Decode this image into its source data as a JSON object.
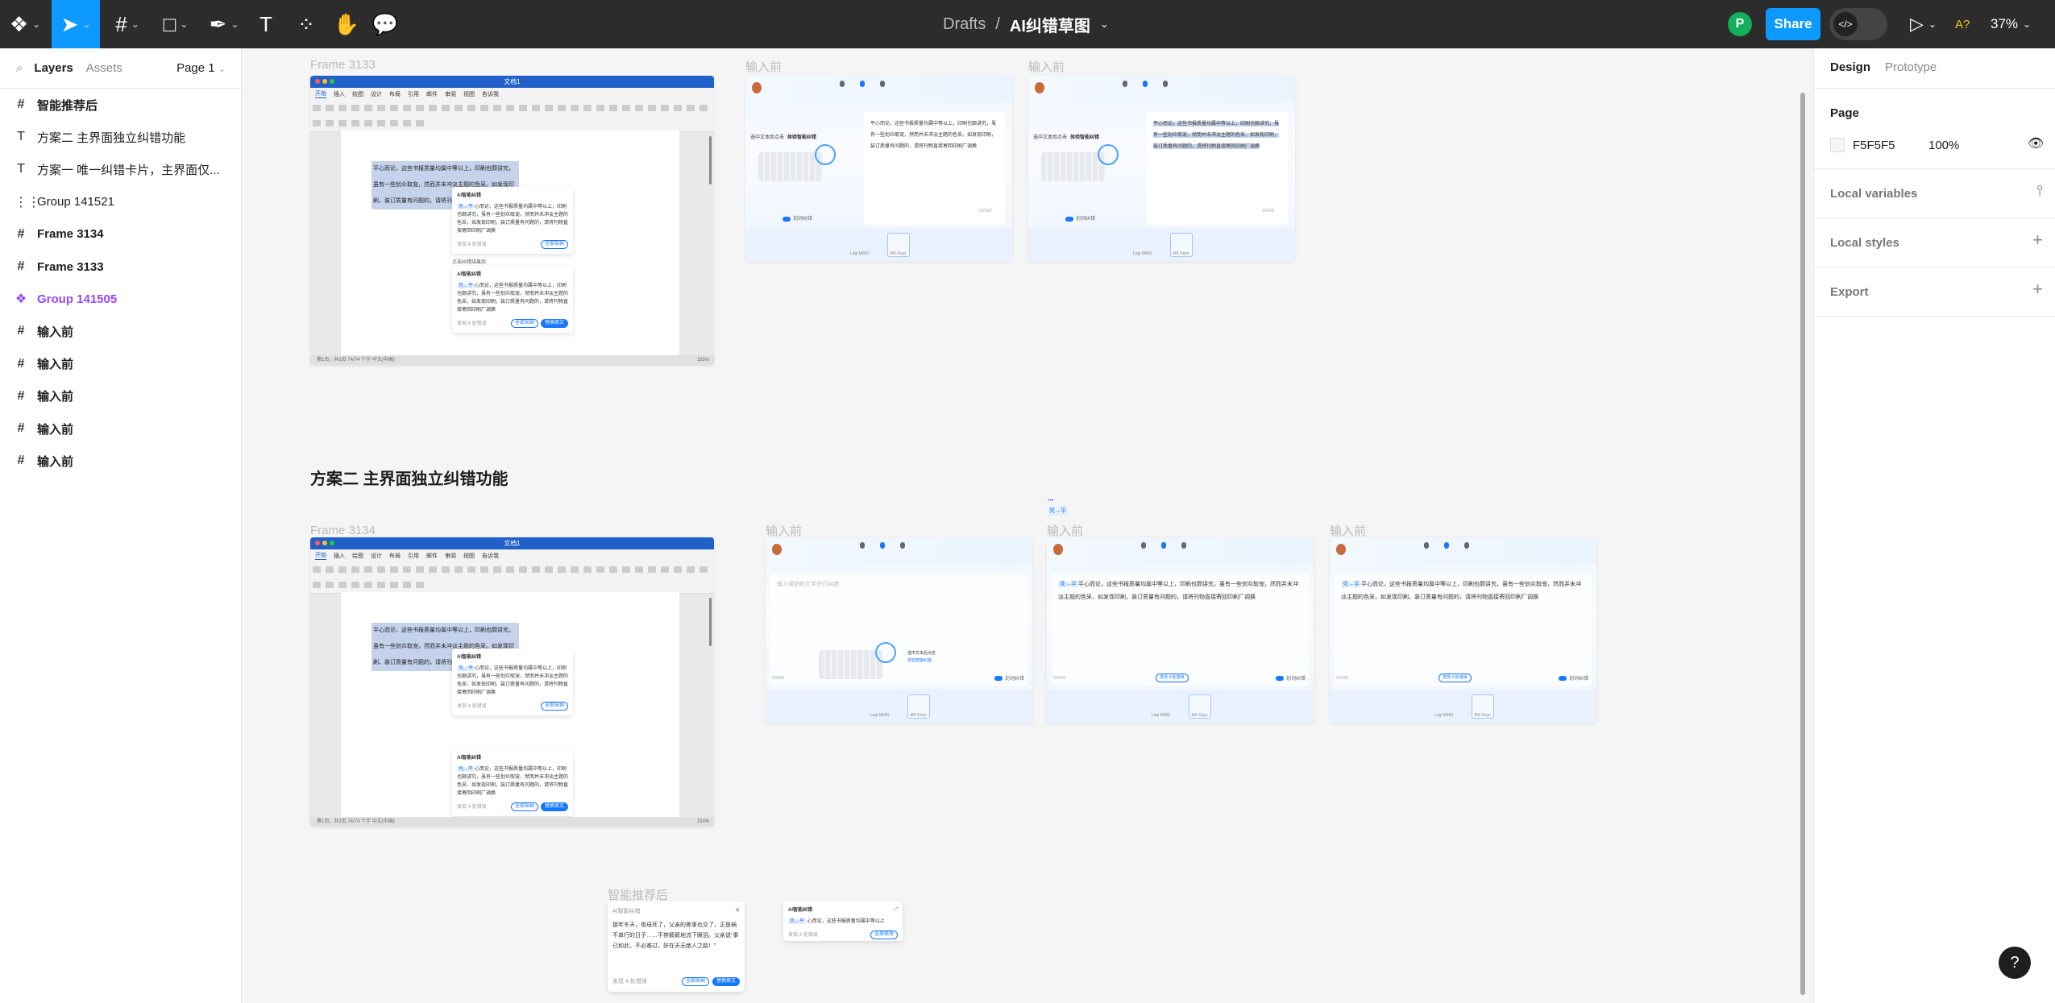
{
  "toolbar": {
    "tools": [
      "figma-menu-icon",
      "move-tool-icon",
      "frame-tool-icon",
      "shape-tool-icon",
      "pen-tool-icon",
      "text-tool-icon",
      "resources-icon",
      "hand-tool-icon",
      "comment-tool-icon"
    ],
    "breadcrumb_root": "Drafts",
    "breadcrumb_sep": "/",
    "file_name": "AI纠错草图",
    "avatar_initial": "P",
    "share_label": "Share",
    "dev_mode_label": "</>",
    "accessibility_label": "A?",
    "zoom_level": "37%",
    "accent_color": "#0d99ff"
  },
  "left_panel": {
    "tabs": {
      "layers": "Layers",
      "assets": "Assets"
    },
    "page_selector": "Page 1",
    "layers": [
      {
        "icon": "#",
        "label": "智能推荐后",
        "bold": true
      },
      {
        "icon": "T",
        "label": "方案二 主界面独立纠错功能",
        "bold": false
      },
      {
        "icon": "T",
        "label": "方案一 唯一纠错卡片，主界面仅...",
        "bold": false
      },
      {
        "icon": "⋮⋮",
        "label": "Group 141521",
        "bold": false
      },
      {
        "icon": "#",
        "label": "Frame 3134",
        "bold": true
      },
      {
        "icon": "#",
        "label": "Frame 3133",
        "bold": true
      },
      {
        "icon": "❖",
        "label": "Group 141505",
        "bold": true,
        "component": true
      },
      {
        "icon": "#",
        "label": "输入前",
        "bold": true
      },
      {
        "icon": "#",
        "label": "输入前",
        "bold": true
      },
      {
        "icon": "#",
        "label": "输入前",
        "bold": true
      },
      {
        "icon": "#",
        "label": "输入前",
        "bold": true
      },
      {
        "icon": "#",
        "label": "输入前",
        "bold": true
      }
    ]
  },
  "right_panel": {
    "tabs": {
      "design": "Design",
      "prototype": "Prototype"
    },
    "page_heading": "Page",
    "page_color": "F5F5F5",
    "page_opacity": "100%",
    "sections": [
      "Local variables",
      "Local styles",
      "Export"
    ]
  },
  "canvas": {
    "frame_3133_label": "Frame 3133",
    "frame_3134_label": "Frame 3134",
    "input_label": "输入前",
    "section_title": "方案二 主界面独立纠错功能",
    "smart_label": "智能推荐后",
    "small_tag": "凭→平",
    "word": {
      "doc_title": "文档1",
      "tabs": [
        "开始",
        "插入",
        "绘图",
        "设计",
        "布局",
        "引用",
        "邮件",
        "审阅",
        "视图",
        "告诉我"
      ],
      "selected_text": "平心而论，这些书报质量均属中等以上，印刷也颇讲究，虽有一些划众取宠，然而并未冲淡主题的色采。如发现印刷、装订质量有问题的，请将刊物直接寄回印刷厂调换",
      "status": "第1页，共1页   74/74 个字   中文(中国)",
      "zoom": "153%",
      "after_click_label": "点击纠错结果后:"
    },
    "ai_card": {
      "title": "AI智能纠错",
      "text": "心而论，这些书报质量均属中等以上，印刷也颇讲究，虽有一些划众取宠，然而并未冲淡主题的色采，如发现印刷，装订质量有问题的，请将刊物直接寄回印刷厂调换",
      "fix": "凭→平",
      "found": "发现 4 处错误",
      "accept_all": "全部采纳",
      "replace": "替换原文"
    },
    "input_frame": {
      "placeholder": "输入或粘贴文字进行纠错",
      "hint": "选中文本后点击",
      "hint_action": "体验智能纠错",
      "toggle": "划词纠错",
      "count": "0/2000",
      "devices": [
        "Logi M650",
        "MX Keys"
      ],
      "text": "平心而论，这些书报质量均属中等以上，印刷也颇讲究，虽有一些划众取宠，然而并未冲淡主题的色采，如发现印刷，装订质量有问题的，请将刊物直接寄回印刷厂调换"
    },
    "smart_card": {
      "title": "AI智能纠错",
      "text": "那年冬天，祖母死了，父亲的差事也交了，正是祸不单行的日子……不禁簌簌地流下眼泪。父亲说“事已如此，不必难过，好在天无绝人之路！”",
      "found": "发现 4 处错误",
      "accept_all": "全部采纳",
      "replace": "替换原文"
    },
    "small_card": {
      "title": "AI智能纠错",
      "text": "心而论，这些书报质量均属中等以上",
      "found": "发现 4 处错误",
      "accept_all": "全部修改"
    }
  },
  "help_label": "?"
}
